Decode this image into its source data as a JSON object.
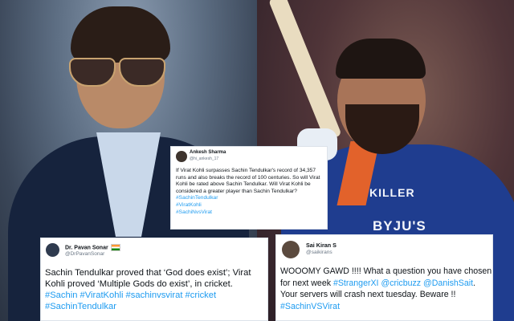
{
  "tweets": {
    "center": {
      "name": "Ankesh Sharma",
      "handle": "@hi_ankesh_17",
      "text": "If Virat Kohli surpasses Sachin Tendulkar's record of 34,357 runs and also breaks the record of 100 centuries. So will Virat Kohli be rated above Sachin Tendulkar. Will Virat Kohli be considered a greater player than Sachin Tendulkar?",
      "hashtags": [
        "#SachinTendulkar",
        "#ViratKohli",
        "#SachiNvsVirat"
      ]
    },
    "left": {
      "name": "Dr. Pavan Sonar",
      "handle": "@DrPavanSonar",
      "text": "Sachin Tendulkar proved that ‘God does exist’; Virat Kohli proved ‘Multiple Gods do exist’, in cricket.",
      "hashtags_line1": "#Sachin #ViratKohli #sachinvsvirat #cricket",
      "hashtags_line2": "#SachinTendulkar"
    },
    "right": {
      "name": "Sai Kiran S",
      "handle": "@saikirans",
      "text_1": "WOOOMY GAWD !!!! What a question you have chosen for next week",
      "tag_1": "#StrangerXI",
      "tag_2": "@cricbuzz",
      "tag_3": "@DanishSait",
      "text_2": ". Your servers will crash next tuesday. Beware !!",
      "tag_4": "#SachinVSVirat"
    }
  },
  "photo_text": {
    "jersey_brand": "KILLER",
    "sponsor": "BYJU'S"
  }
}
